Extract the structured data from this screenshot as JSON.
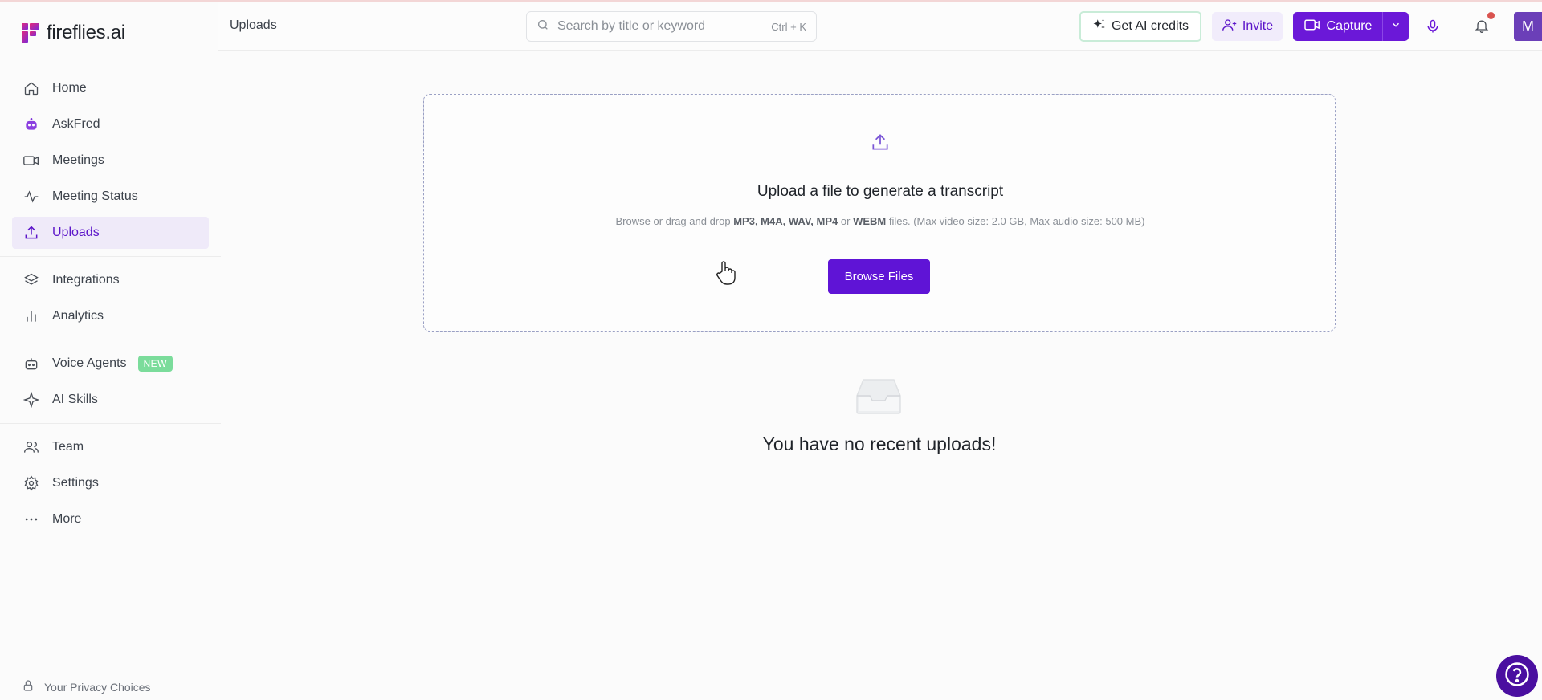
{
  "brand": {
    "name": "fireflies.ai"
  },
  "sidebar": {
    "items": [
      {
        "label": "Home"
      },
      {
        "label": "AskFred"
      },
      {
        "label": "Meetings"
      },
      {
        "label": "Meeting Status"
      },
      {
        "label": "Uploads"
      },
      {
        "label": "Integrations"
      },
      {
        "label": "Analytics"
      },
      {
        "label": "Voice Agents",
        "badge": "NEW"
      },
      {
        "label": "AI Skills"
      },
      {
        "label": "Team"
      },
      {
        "label": "Settings"
      },
      {
        "label": "More"
      }
    ],
    "privacy": "Your Privacy Choices"
  },
  "header": {
    "breadcrumb": "Uploads",
    "search_placeholder": "Search by title or keyword",
    "search_shortcut": "Ctrl + K",
    "credits_label": "Get AI credits",
    "invite_label": "Invite",
    "capture_label": "Capture",
    "avatar_initial": "M"
  },
  "upload": {
    "title": "Upload a file to generate a transcript",
    "sub_prefix": "Browse or drag and drop ",
    "formats": "MP3, M4A, WAV, MP4",
    "sub_or": " or ",
    "format_last": "WEBM",
    "sub_suffix": " files. (Max video size: 2.0 GB, Max audio size: 500 MB)",
    "browse_label": "Browse Files"
  },
  "empty": {
    "message": "You have no recent uploads!"
  },
  "colors": {
    "accent": "#5f14d6",
    "active_bg": "#efeaf9",
    "badge_green": "#7bdc9b"
  }
}
